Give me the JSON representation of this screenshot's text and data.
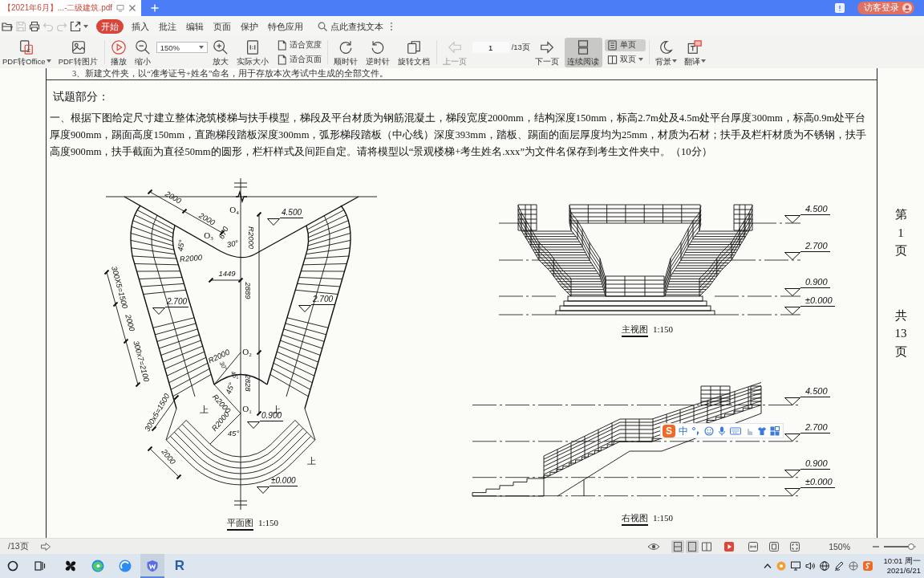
{
  "tab_bar": {
    "tabs": [
      {
        "title": "【2021年6月】...-二级建筑.pdf",
        "selected": true
      }
    ],
    "login_button": "访客登录"
  },
  "menu_bar": {
    "quick_actions": [
      {
        "disabled": false
      },
      {
        "disabled": true
      },
      {
        "disabled": false
      },
      {
        "disabled": true
      },
      {
        "disabled": true
      },
      {
        "disabled": false
      }
    ],
    "tabs": [
      {
        "label": "开始",
        "selected": true
      },
      {
        "label": "插入",
        "selected": false
      },
      {
        "label": "批注",
        "selected": false
      },
      {
        "label": "编辑",
        "selected": false
      },
      {
        "label": "页面",
        "selected": false
      },
      {
        "label": "保护",
        "selected": false
      },
      {
        "label": "特色应用",
        "selected": false
      }
    ],
    "search": {
      "placeholder": "点此查找文本"
    }
  },
  "toolbar": {
    "groups": [
      {
        "items": [
          {
            "kind": "button",
            "label": "PDF转Office",
            "dropdown": true,
            "selected": false,
            "disabled": false
          },
          {
            "kind": "button",
            "label": "PDF转图片",
            "dropdown": false,
            "selected": false,
            "disabled": false
          }
        ]
      },
      {
        "items": [
          {
            "kind": "button",
            "label": "播放",
            "dropdown": false,
            "selected": false,
            "disabled": false
          },
          {
            "kind": "button",
            "label": "缩小",
            "dropdown": false,
            "selected": false,
            "disabled": false
          },
          {
            "kind": "select",
            "value": "150%"
          },
          {
            "kind": "button",
            "label": "放大",
            "dropdown": false,
            "selected": false,
            "disabled": false
          },
          {
            "kind": "button",
            "label": "实际大小",
            "dropdown": false,
            "selected": false,
            "disabled": false
          },
          {
            "kind": "stack",
            "items": [
              {
                "label": "适合宽度",
                "dropdown": false,
                "selected": false
              },
              {
                "label": "适合页面",
                "dropdown": false,
                "selected": false
              }
            ]
          }
        ]
      },
      {
        "items": [
          {
            "kind": "button",
            "label": "顺时针",
            "dropdown": false,
            "selected": false,
            "disabled": false
          },
          {
            "kind": "button",
            "label": "逆时针",
            "dropdown": false,
            "selected": false,
            "disabled": false
          },
          {
            "kind": "button",
            "label": "旋转文档",
            "dropdown": false,
            "selected": false,
            "disabled": false
          }
        ]
      },
      {
        "items": [
          {
            "kind": "button",
            "label": "上一页",
            "dropdown": false,
            "selected": false,
            "disabled": true
          },
          {
            "kind": "page",
            "value": "1",
            "total": "/13页"
          },
          {
            "kind": "button",
            "label": "下一页",
            "dropdown": false,
            "selected": false,
            "disabled": false
          },
          {
            "kind": "button",
            "label": "连续阅读",
            "dropdown": false,
            "selected": true,
            "disabled": false
          },
          {
            "kind": "stack",
            "items": [
              {
                "label": "单页",
                "dropdown": false,
                "selected": true
              },
              {
                "label": "双页",
                "dropdown": true,
                "selected": false
              }
            ]
          }
        ]
      },
      {
        "items": [
          {
            "kind": "button",
            "label": "背景",
            "dropdown": true,
            "selected": false,
            "disabled": false
          },
          {
            "kind": "button",
            "label": "翻译",
            "dropdown": true,
            "selected": false,
            "disabled": false
          }
        ]
      }
    ]
  },
  "document": {
    "prev_line": "3、新建文件夹，以“准考证号+姓名”命名，用于存放本次考试中生成的全部文件。",
    "section_title": "试题部分：",
    "question": "一、根据下图给定尺寸建立整体浇筑楼梯与扶手模型，梯段及平台材质为钢筋混凝土，梯段宽度2000mm，结构深度150mm，标高2.7m处及4.5m处平台厚度300mm，标高0.9m处平台厚度900mm，踢面高度150mm，直跑梯段踏板深度300mm，弧形梯段踏板（中心线）深度393mm，踏板、踢面的面层厚度均为25mm，材质为石材；扶手及栏杆材质为不锈钢，扶手高度900mm，扶手截面为直径50mm的圆形，栏杆样式及间距自定。请将模型以“景观楼梯+考生姓名.xxx”为文件名保存到考生文件夹中。（10分）",
    "plan_view": {
      "labels": [
        {
          "text": "2000",
          "kind": "dimension"
        },
        {
          "text": "2000",
          "kind": "dimension"
        },
        {
          "text": "O$_{4}$",
          "kind": "center"
        },
        {
          "text": "4.500",
          "kind": "level"
        },
        {
          "text": "O$_{3}$",
          "kind": "center"
        },
        {
          "text": "670",
          "kind": "dimension"
        },
        {
          "text": "R2000",
          "kind": "dimension"
        },
        {
          "text": "45°",
          "kind": "dimension"
        },
        {
          "text": "30°",
          "kind": "dimension"
        },
        {
          "text": "R2000",
          "kind": "dimension"
        },
        {
          "text": "1449",
          "kind": "dimension"
        },
        {
          "text": "2889",
          "kind": "dimension"
        },
        {
          "text": "300X5=1500",
          "kind": "dimension"
        },
        {
          "text": "2000",
          "kind": "dimension"
        },
        {
          "text": "300x7=2100",
          "kind": "dimension"
        },
        {
          "text": "2.700",
          "kind": "level"
        },
        {
          "text": "2.700",
          "kind": "level"
        },
        {
          "text": "O$_{2}$",
          "kind": "center"
        },
        {
          "text": "R2000",
          "kind": "dimension"
        },
        {
          "text": "30°",
          "kind": "dimension"
        },
        {
          "text": "45°",
          "kind": "dimension"
        },
        {
          "text": "45°",
          "kind": "dimension"
        },
        {
          "text": "2828",
          "kind": "dimension"
        },
        {
          "text": "R2000",
          "kind": "dimension"
        },
        {
          "text": "上",
          "kind": "direction"
        },
        {
          "text": "O$_{1}$",
          "kind": "center"
        },
        {
          "text": "上",
          "kind": "direction"
        },
        {
          "text": "0.900",
          "kind": "level"
        },
        {
          "text": "300x5=1500",
          "kind": "dimension"
        },
        {
          "text": "R2000",
          "kind": "dimension"
        },
        {
          "text": "45°",
          "kind": "dimension"
        },
        {
          "text": "2000",
          "kind": "dimension"
        },
        {
          "text": "上",
          "kind": "direction"
        },
        {
          "text": "±0.000",
          "kind": "level"
        }
      ],
      "title": "平面图",
      "scale": "1:150"
    },
    "front_view": {
      "levels": [
        "4.500",
        "2.700",
        "0.900",
        "±0.000"
      ],
      "title": "主视图",
      "scale": "1:150"
    },
    "side_view": {
      "levels": [
        "4.500",
        "2.700",
        "0.900",
        "±0.000"
      ],
      "title": "右视图",
      "scale": "1:150"
    },
    "page_number": "第1页",
    "page_total": "共13页"
  },
  "ime_toolbar": {
    "logo": "S",
    "mode": "中"
  },
  "status_bar": {
    "page_total": "/13页",
    "view_modes": [
      {
        "selected": true
      },
      {
        "selected": true
      },
      {
        "selected": false
      }
    ],
    "zoom": "150%",
    "zoom_slider": {
      "level": 0.95
    }
  },
  "taskbar": {
    "apps": [
      {
        "selected": false
      },
      {
        "selected": false
      },
      {
        "selected": false
      },
      {
        "selected": true
      },
      {
        "label": "R",
        "selected": false
      }
    ],
    "time": "10:01 周一",
    "date": "2021/6/21"
  }
}
